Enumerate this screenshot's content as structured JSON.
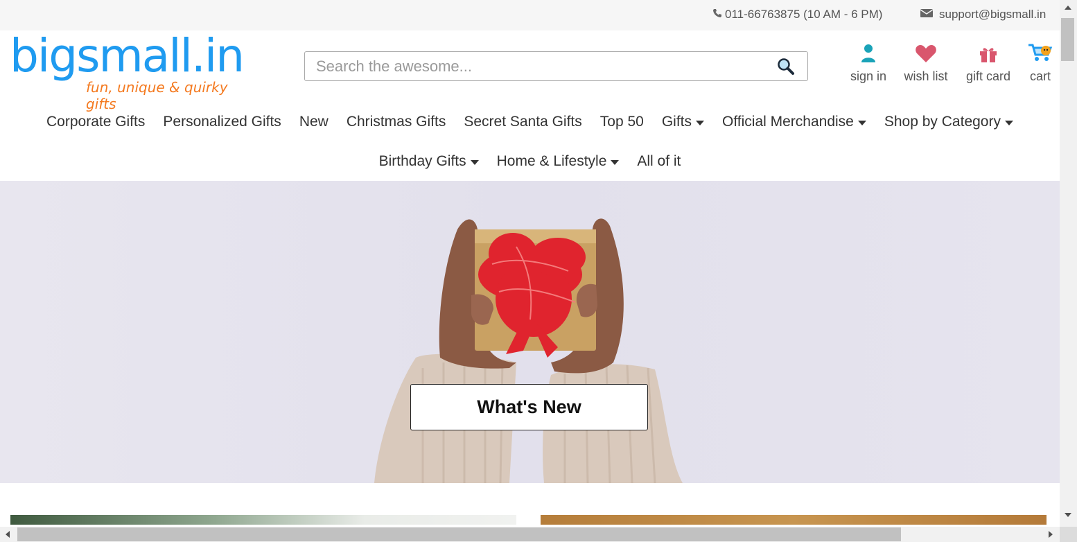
{
  "topbar": {
    "phone": "011-66763875 (10 AM - 6 PM)",
    "email": "support@bigsmall.in"
  },
  "logo": {
    "brand": "bigsmall.in",
    "tagline": "fun, unique & quirky gifts",
    "brand_color": "#1f9bf0",
    "tagline_color": "#f47a20"
  },
  "search": {
    "placeholder": "Search the awesome...",
    "icon": "search-icon"
  },
  "account": {
    "sign_in": "sign in",
    "wish_list": "wish list",
    "gift_card": "gift card",
    "cart": "cart"
  },
  "nav": {
    "row1": [
      {
        "label": "Corporate Gifts",
        "dropdown": false
      },
      {
        "label": "Personalized Gifts",
        "dropdown": false
      },
      {
        "label": "New",
        "dropdown": false
      },
      {
        "label": "Christmas Gifts",
        "dropdown": false
      },
      {
        "label": "Secret Santa Gifts",
        "dropdown": false
      },
      {
        "label": "Top 50",
        "dropdown": false
      },
      {
        "label": "Gifts",
        "dropdown": true
      },
      {
        "label": "Official Merchandise",
        "dropdown": true
      },
      {
        "label": "Shop by Category",
        "dropdown": true
      }
    ],
    "row2": [
      {
        "label": "Birthday Gifts",
        "dropdown": true
      },
      {
        "label": "Home & Lifestyle",
        "dropdown": true
      },
      {
        "label": "All of it",
        "dropdown": false
      }
    ]
  },
  "hero": {
    "cta_label": "What's New"
  },
  "colors": {
    "icon_teal": "#1aa3b8",
    "icon_pink": "#d9566d"
  }
}
